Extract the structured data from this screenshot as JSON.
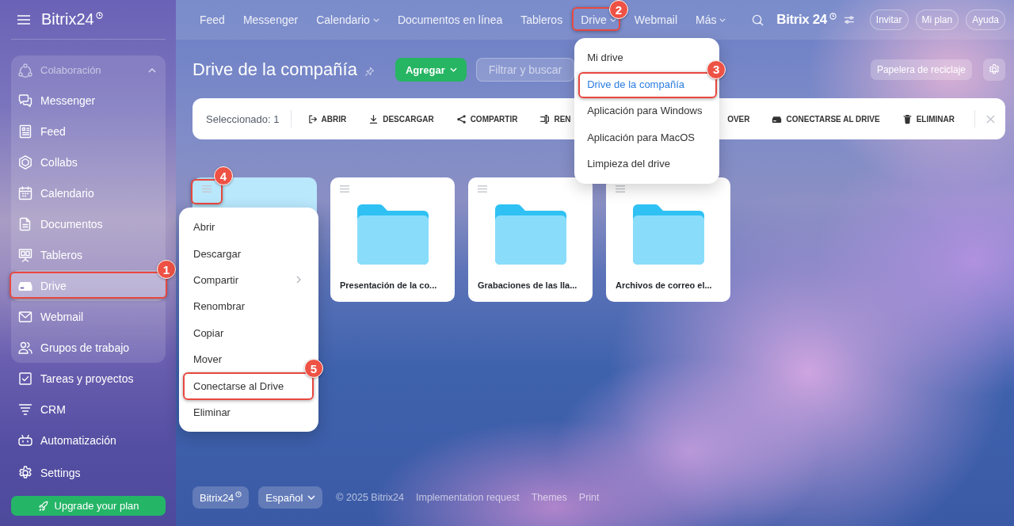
{
  "sidebar": {
    "logo": "Bitrix24",
    "group": {
      "title": "Colaboración",
      "expanded": true,
      "items": [
        {
          "label": "Messenger",
          "selected": false
        },
        {
          "label": "Feed",
          "selected": false
        },
        {
          "label": "Collabs",
          "selected": false
        },
        {
          "label": "Calendario",
          "selected": false
        },
        {
          "label": "Documentos",
          "selected": false
        },
        {
          "label": "Tableros",
          "selected": false
        },
        {
          "label": "Drive",
          "selected": true,
          "callout": "1"
        },
        {
          "label": "Webmail",
          "selected": false
        },
        {
          "label": "Grupos de trabajo",
          "selected": false
        }
      ]
    },
    "items": [
      {
        "label": "Tareas y proyectos",
        "selected": false
      },
      {
        "label": "CRM",
        "selected": false
      },
      {
        "label": "Automatización",
        "selected": false
      },
      {
        "label": "Settings",
        "selected": false
      }
    ],
    "upgrade_button": "Upgrade your plan"
  },
  "top_nav": {
    "items": [
      {
        "label": "Feed",
        "has_menu": false
      },
      {
        "label": "Messenger",
        "has_menu": false
      },
      {
        "label": "Calendario",
        "has_menu": true
      },
      {
        "label": "Documentos en línea",
        "has_menu": false
      },
      {
        "label": "Tableros",
        "has_menu": false
      },
      {
        "label": "Drive",
        "has_menu": true,
        "callout": "2",
        "menu": {
          "items": [
            {
              "label": "Mi drive",
              "selected": false
            },
            {
              "label": "Drive de la compañía",
              "selected": true,
              "callout": "3"
            },
            {
              "label": "Aplicación para Windows",
              "selected": false
            },
            {
              "label": "Aplicación para MacOS",
              "selected": false
            },
            {
              "label": "Limpieza del drive",
              "selected": false
            }
          ]
        }
      },
      {
        "label": "Webmail",
        "has_menu": false
      },
      {
        "label": "Más",
        "has_menu": true
      }
    ],
    "logo": "Bitrix 24",
    "buttons": [
      "Invitar",
      "Mi plan",
      "Ayuda"
    ]
  },
  "page": {
    "title": "Drive de la compañía",
    "add_button": "Agregar",
    "search": {
      "placeholder": "Filtrar y buscar"
    },
    "trash_button": "Papelera de reciclaje"
  },
  "selection_bar": {
    "count": "Seleccionado: 1",
    "actions": [
      {
        "label": "ABRIR"
      },
      {
        "label": "DESCARGAR"
      },
      {
        "label": "COMPARTIR"
      },
      {
        "label": "REN"
      },
      {
        "label": "OVER"
      },
      {
        "label": "CONECTARSE AL DRIVE"
      },
      {
        "label": "ELIMINAR"
      }
    ]
  },
  "folders": [
    {
      "selected": true,
      "callout": "4",
      "menu": {
        "items": [
          {
            "label": "Abrir",
            "submenu": false
          },
          {
            "label": "Descargar",
            "submenu": false
          },
          {
            "label": "Compartir",
            "submenu": true
          },
          {
            "label": "Renombrar",
            "submenu": false
          },
          {
            "label": "Copiar",
            "submenu": false
          },
          {
            "label": "Mover",
            "submenu": false
          },
          {
            "label": "Conectarse al Drive",
            "submenu": false,
            "callout": "5"
          },
          {
            "label": "Eliminar",
            "submenu": false
          }
        ]
      }
    },
    {
      "name": "Presentación de la co...",
      "selected": false
    },
    {
      "name": "Grabaciones de las lla...",
      "selected": false
    },
    {
      "name": "Archivos de correo el...",
      "selected": false
    }
  ],
  "footer": {
    "logo": "Bitrix24",
    "language": "Español",
    "copyright": "© 2025 Bitrix24",
    "links": [
      "Implementation request",
      "Themes",
      "Print"
    ]
  }
}
